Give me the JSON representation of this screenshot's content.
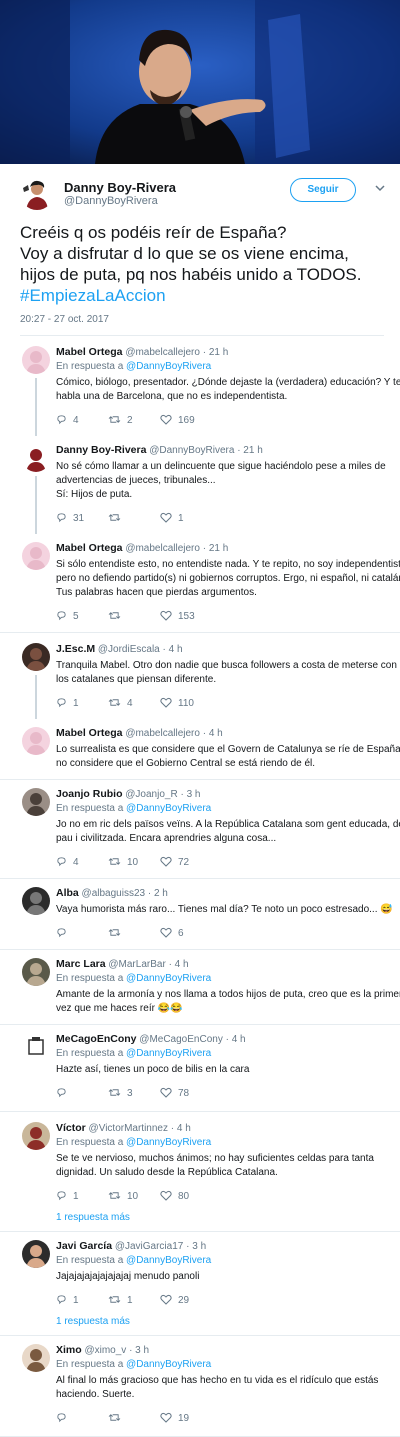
{
  "main_tweet": {
    "display_name": "Danny Boy-Rivera",
    "handle": "@DannyBoyRivera",
    "follow_label": "Seguir",
    "text_lines": [
      "Creéis q os podéis reír de España?",
      "Voy a disfrutar d lo que se os viene encima,",
      "hijos de puta, pq nos habéis unido a TODOS."
    ],
    "hashtag": "#EmpiezaLaAccion",
    "timestamp": "20:27 - 27 oct. 2017"
  },
  "replies": [
    {
      "name": "Mabel Ortega",
      "handle": "@mabelcallejero",
      "time": "· 21 h",
      "reply_to_prefix": "En respuesta a ",
      "reply_to": "@DannyBoyRivera",
      "text_lines": [
        "Cómico, biólogo, presentador. ¿Dónde dejaste la (verdadera) educación? Y te",
        "habla una de Barcelona, que no es independentista."
      ],
      "replies_count": "4",
      "retweets": "2",
      "likes": "169"
    },
    {
      "name": "Danny Boy-Rivera",
      "handle": "@DannyBoyRivera",
      "time": "· 21 h",
      "text_lines": [
        "No sé cómo llamar a un delincuente que sigue haciéndolo pese a miles de",
        "advertencias de jueces, tribunales...",
        "Sí: Hijos de puta."
      ],
      "replies_count": "31",
      "retweets": "",
      "likes": "1"
    },
    {
      "name": "Mabel Ortega",
      "handle": "@mabelcallejero",
      "time": "· 21 h",
      "text_lines": [
        "Si sólo entendiste esto, no entendiste nada. Y te repito, no soy independentista",
        "pero no defiendo partido(s) ni gobiernos corruptos. Ergo, ni español, ni catalán.",
        "Tus palabras hacen que pierdas argumentos."
      ],
      "replies_count": "5",
      "retweets": "",
      "likes": "153"
    },
    {
      "name": "J.Esc.M",
      "handle": "@JordiEscala",
      "time": "· 4 h",
      "text_lines": [
        "Tranquila Mabel. Otro don nadie que busca followers a costa de meterse con",
        "los catalanes que piensan diferente."
      ],
      "replies_count": "1",
      "retweets": "4",
      "likes": "110"
    },
    {
      "name": "Mabel Ortega",
      "handle": "@mabelcallejero",
      "time": "· 4 h",
      "text_lines": [
        "Lo surrealista es que considere que el Govern de Catalunya se ríe de España y",
        "no considere que el Gobierno Central se está riendo de él."
      ]
    },
    {
      "name": "Joanjo Rubio",
      "handle": "@Joanjo_R",
      "time": "· 3 h",
      "reply_to_prefix": "En respuesta a ",
      "reply_to": "@DannyBoyRivera",
      "text_lines": [
        "Jo no em ric dels països veïns. A la República Catalana som gent educada, de",
        "pau i civilitzada. Encara aprendries alguna cosa..."
      ],
      "replies_count": "4",
      "retweets": "10",
      "likes": "72"
    },
    {
      "name": "Alba",
      "handle": "@albaguiss23",
      "time": "· 2 h",
      "text_lines": [
        "Vaya humorista más raro... Tienes mal día? Te noto un poco estresado... 😅"
      ],
      "replies_count": "",
      "retweets": "",
      "likes": "6"
    },
    {
      "name": "Marc Lara",
      "handle": "@MarLarBar",
      "time": "· 4 h",
      "reply_to_prefix": "En respuesta a ",
      "reply_to": "@DannyBoyRivera",
      "text_lines": [
        "Amante de la armonía  y nos llama a todos hijos de puta, creo que es la primera",
        "vez que me haces reír 😂😂"
      ]
    },
    {
      "name": "MeCagoEnCony",
      "handle": "@MeCagoEnCony",
      "time": "· 4 h",
      "reply_to_prefix": "En respuesta a ",
      "reply_to": "@DannyBoyRivera",
      "text_lines": [
        "Hazte así, tienes un poco de bilis en la cara"
      ],
      "replies_count": "",
      "retweets": "3",
      "likes": "78"
    },
    {
      "name": "Víctor",
      "handle": "@VictorMartinnez",
      "time": "· 4 h",
      "reply_to_prefix": "En respuesta a ",
      "reply_to": "@DannyBoyRivera",
      "text_lines": [
        "Se te ve nervioso, muchos ánimos; no hay suficientes celdas para tanta",
        "dignidad. Un saludo desde la República Catalana."
      ],
      "replies_count": "1",
      "retweets": "10",
      "likes": "80",
      "more": "1 respuesta más"
    },
    {
      "name": "Javi García",
      "handle": "@JaviGarcia17",
      "time": "· 3 h",
      "reply_to_prefix": "En respuesta a ",
      "reply_to": "@DannyBoyRivera",
      "text_lines": [
        "Jajajajajajajajajaj menudo panoli"
      ],
      "replies_count": "1",
      "retweets": "1",
      "likes": "29",
      "more": "1 respuesta más"
    },
    {
      "name": "Ximo",
      "handle": "@ximo_v",
      "time": "· 3 h",
      "reply_to_prefix": "En respuesta a ",
      "reply_to": "@DannyBoyRivera",
      "text_lines": [
        "Al final lo más gracioso que has hecho en tu vida es el ridículo que estás",
        "haciendo. Suerte."
      ],
      "replies_count": "",
      "retweets": "",
      "likes": "19"
    }
  ],
  "icons": {
    "reply": "reply-icon",
    "retweet": "retweet-icon",
    "like": "heart-icon",
    "menu": "chevron-down-icon"
  },
  "colors": {
    "link": "#1da1f2",
    "muted": "#657786",
    "divider": "#e6ecf0"
  }
}
